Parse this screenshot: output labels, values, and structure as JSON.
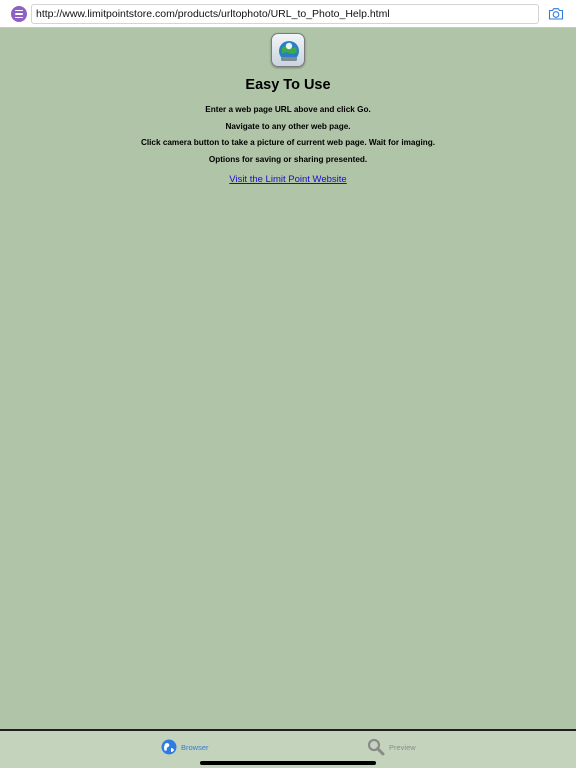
{
  "toolbar": {
    "url_value": "http://www.limitpointstore.com/products/urltophoto/URL_to_Photo_Help.html",
    "menu_icon": "menu-icon",
    "camera_icon": "camera-icon"
  },
  "help": {
    "title": "Easy To Use",
    "lines": [
      "Enter a web page URL above and click Go.",
      "Navigate to any other web page.",
      "Click camera button to take a picture of current web page. Wait for imaging.",
      "Options for saving or sharing presented."
    ],
    "link_text": "Visit the Limit Point Website"
  },
  "tabs": [
    {
      "label": "Browser",
      "icon": "globe-icon",
      "selected": true
    },
    {
      "label": "Preview",
      "icon": "magnifier-icon",
      "selected": false
    }
  ],
  "colors": {
    "background": "#b0c4a8",
    "accent": "#2f7be0",
    "menu_button": "#8e5fc4",
    "link": "#1a0dcc"
  }
}
